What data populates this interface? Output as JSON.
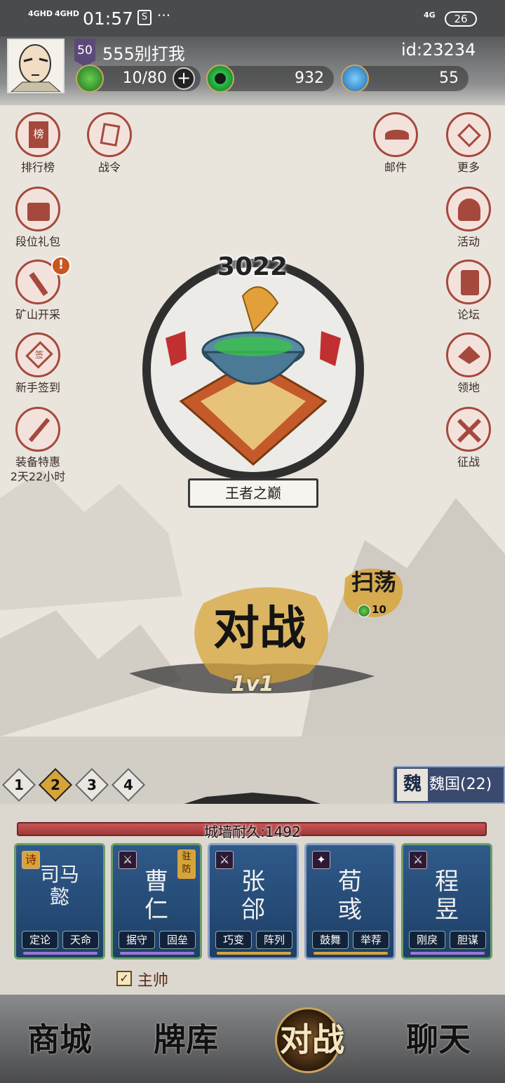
{
  "status_bar": {
    "signal1": "4GHD",
    "signal2": "4GHD",
    "time": "01:57",
    "dots": "···",
    "net": "4G",
    "battery": "26"
  },
  "player": {
    "level": "50",
    "name": "555别打我",
    "id": "id:23234"
  },
  "resources": {
    "energy": "10/80",
    "energy_add": "+",
    "jade": "932",
    "gems": "55"
  },
  "left_menu": [
    {
      "label": "排行榜",
      "icon": "leaderboard-icon",
      "glyph": "榜"
    },
    {
      "label": "段位礼包",
      "icon": "gift-bag-icon"
    },
    {
      "label": "矿山开采",
      "icon": "pickaxe-icon",
      "badge": "!"
    },
    {
      "label": "新手签到",
      "icon": "checkin-icon",
      "glyph": "签"
    },
    {
      "label": "装备特惠",
      "sub": "2天22小时",
      "icon": "equipment-sale-icon"
    }
  ],
  "top_menu": [
    {
      "label": "战令",
      "icon": "battle-pass-icon"
    }
  ],
  "right_menu": [
    {
      "label": "邮件",
      "icon": "mail-icon"
    },
    {
      "label": "更多",
      "icon": "more-icon"
    },
    {
      "label": "活动",
      "icon": "activity-icon"
    },
    {
      "label": "论坛",
      "icon": "forum-icon"
    },
    {
      "label": "领地",
      "icon": "territory-icon"
    },
    {
      "label": "征战",
      "icon": "crossed-swords-icon"
    }
  ],
  "rank": {
    "score": "3022",
    "name": "王者之巅"
  },
  "battle": {
    "label": "对战",
    "mode": "1v1"
  },
  "sweep": {
    "label": "扫荡",
    "cost": "10"
  },
  "teams": [
    "1",
    "2",
    "3",
    "4"
  ],
  "nation": {
    "seal": "魏",
    "label": "魏国(22)"
  },
  "wall": {
    "label": "城墙耐久:1492",
    "color": "#b34040"
  },
  "cards": [
    {
      "name": "司马\n懿",
      "icon": "诗",
      "skills": [
        "定论",
        "天命"
      ]
    },
    {
      "name": "曹\n仁",
      "icon": "⚔",
      "tag": "驻\n防",
      "skills": [
        "据守",
        "固垒"
      ]
    },
    {
      "name": "张\n郃",
      "icon": "⚔",
      "skills": [
        "巧变",
        "阵列"
      ]
    },
    {
      "name": "荀\n彧",
      "icon": "✦",
      "skills": [
        "鼓舞",
        "举荐"
      ]
    },
    {
      "name": "程\n昱",
      "icon": "⚔",
      "skills": [
        "刚戾",
        "胆谋"
      ]
    }
  ],
  "commander": {
    "checked": true,
    "label": "主帅"
  },
  "bottom_nav": [
    "商城",
    "牌库",
    "对战",
    "聊天"
  ]
}
